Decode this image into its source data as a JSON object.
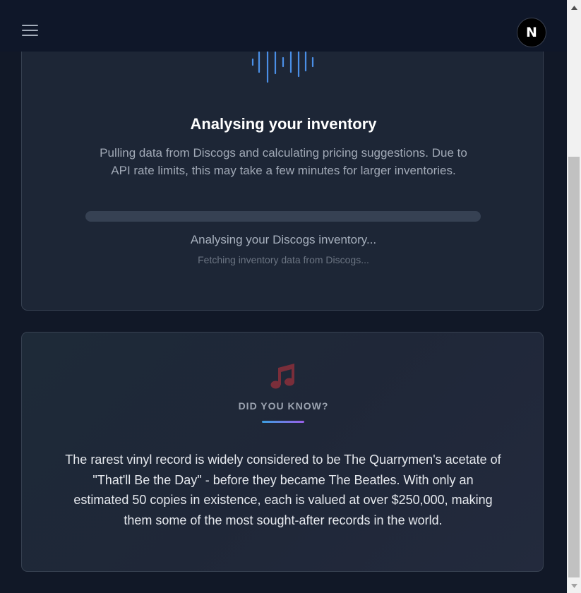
{
  "header": {
    "menu_icon": "hamburger-menu-icon",
    "avatar_letter": "N"
  },
  "progress_card": {
    "icon": "audio-waveform-icon",
    "title": "Analysing your inventory",
    "description": "Pulling data from Discogs and calculating pricing suggestions. Due to API rate limits, this may take a few minutes for larger inventories.",
    "progress_percent": 0,
    "status": "Analysing your Discogs inventory...",
    "substatus": "Fetching inventory data from Discogs..."
  },
  "fact_card": {
    "icon": "music-note-icon",
    "heading": "DID YOU KNOW?",
    "fact": "The rarest vinyl record is widely considered to be The Quarrymen's acetate of \"That'll Be the Day\" - before they became The Beatles. With only an estimated 50 copies in existence, each is valued at over $250,000, making them some of the most sought-after records in the world."
  },
  "colors": {
    "background": "#111827",
    "card": "#1d2636",
    "accent_blue": "#4a86e8",
    "accent_purple": "#9a5fe8",
    "music_icon": "#7a2e3a"
  }
}
